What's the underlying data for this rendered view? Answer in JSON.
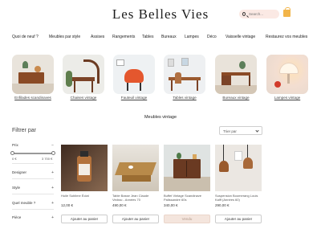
{
  "header": {
    "brand": "Les Belles Vies",
    "search_placeholder": "Search...",
    "search_icon": "magnifier-icon",
    "cart_icon": "shopping-bag-icon"
  },
  "nav": [
    "Quoi de neuf ?",
    "Meubles par style",
    "Assises",
    "Rangements",
    "Tables",
    "Bureaux",
    "Lampes",
    "Déco",
    "Vaisselle vintage",
    "Restaurez vos meubles"
  ],
  "categories": [
    {
      "label": "Enfilades scandinaves"
    },
    {
      "label": "Chaises vintage"
    },
    {
      "label": "Fauteuil vintage"
    },
    {
      "label": "Tables vintage"
    },
    {
      "label": "Bureaux vintage"
    },
    {
      "label": "Lampes vintage"
    }
  ],
  "section_title": "Meubles vintage",
  "filters": {
    "title": "Filtrer par",
    "sort_label": "Trier par",
    "price": {
      "label": "Prix",
      "min": "0 €",
      "max": "3 700 €"
    },
    "facets": [
      "Designer",
      "Style",
      "Quel meuble ?",
      "Pièce"
    ]
  },
  "products": [
    {
      "name": "Huile Sublime Éclat",
      "price": "12,00 €",
      "button": "Ajouter au panier",
      "sold": false
    },
    {
      "name": "Table Basse Jean Claude Vedrac - Années 70",
      "price": "490,00 €",
      "button": "Ajouter au panier",
      "sold": false
    },
    {
      "name": "Buffet Vintage Scandinave Palissandre 60s",
      "price": "340,00 €",
      "button": "Vendu",
      "sold": true
    },
    {
      "name": "Suspension Boomerang Louis Kalff (Années 60)",
      "price": "290,00 €",
      "button": "Ajouter au panier",
      "sold": false
    }
  ],
  "colors": {
    "accent": "#f2b54a",
    "search_bg": "#fbe9e4",
    "sold_bg": "#f4e5dd"
  }
}
